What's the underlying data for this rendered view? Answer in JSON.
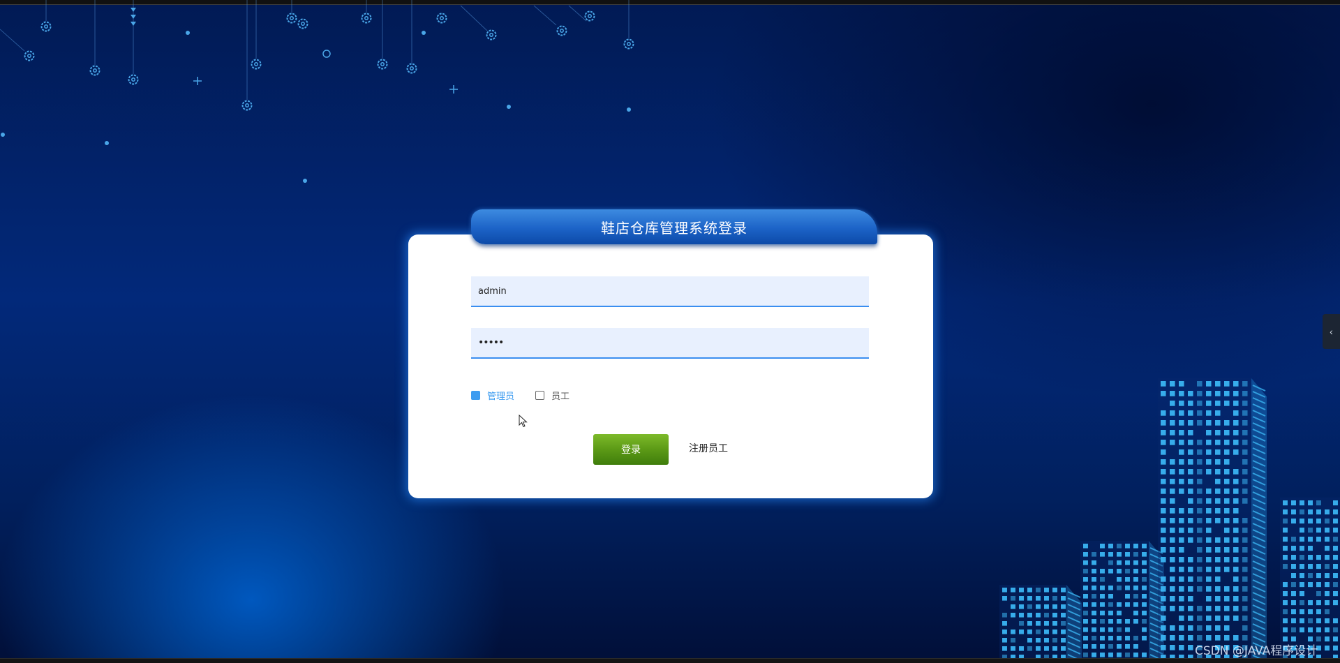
{
  "login": {
    "title": "鞋店仓库管理系统登录",
    "username_value": "admin",
    "password_value": "•••••",
    "roles": [
      {
        "label": "管理员",
        "checked": true
      },
      {
        "label": "员工",
        "checked": false
      }
    ],
    "login_button": "登录",
    "register_link": "注册员工"
  },
  "sidebar_toggle": {
    "icon": "chevron-left-icon",
    "glyph": "‹"
  },
  "watermark": "CSDN @JAVA程序设计",
  "colors": {
    "background": "#02297a",
    "title_tab": "#1c63c7",
    "input_fill": "#e8f0fe",
    "input_underline": "#3a8ef0",
    "checkbox_active": "#3d9cf0",
    "login_button": "#5c9a16",
    "city_lights": "#3ab4f2"
  }
}
